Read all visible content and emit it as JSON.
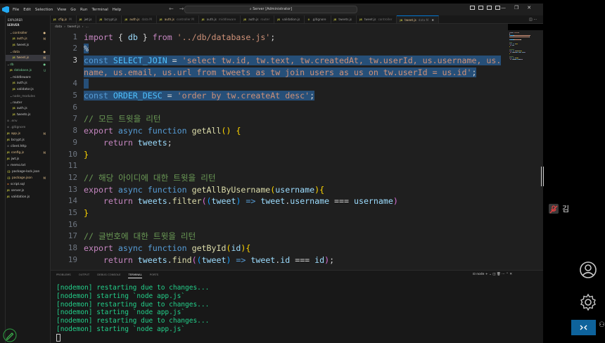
{
  "menu": [
    "File",
    "Edit",
    "Selection",
    "View",
    "Go",
    "Run",
    "Terminal",
    "Help"
  ],
  "command_center": "Server [Administrator]",
  "explorer": {
    "title": "EXPLORER",
    "project": "SERVER",
    "items": [
      {
        "kind": "folder",
        "label": "controller",
        "badge": "●",
        "status": "mod"
      },
      {
        "kind": "js",
        "label": "auth.js",
        "badge": "M",
        "status": "mod"
      },
      {
        "kind": "js",
        "label": "tweet.js",
        "badge": "",
        "status": ""
      },
      {
        "kind": "folder",
        "label": "data",
        "badge": "●",
        "status": "mod"
      },
      {
        "kind": "js",
        "label": "tweet.js",
        "badge": "M",
        "status": "mod",
        "selected": true
      },
      {
        "kind": "folder",
        "label": "db",
        "badge": "●",
        "status": "untr"
      },
      {
        "kind": "js",
        "label": "database.js",
        "badge": "U",
        "status": "untr"
      },
      {
        "kind": "folder",
        "label": "middleware",
        "badge": "",
        "status": ""
      },
      {
        "kind": "js",
        "label": "auth.js",
        "badge": "",
        "status": ""
      },
      {
        "kind": "js",
        "label": "validator.js",
        "badge": "",
        "status": ""
      },
      {
        "kind": "folder",
        "label": "node_modules",
        "badge": "",
        "status": "dim"
      },
      {
        "kind": "folder",
        "label": "router",
        "badge": "",
        "status": ""
      },
      {
        "kind": "js",
        "label": "auth.js",
        "badge": "",
        "status": ""
      },
      {
        "kind": "js",
        "label": "tweets.js",
        "badge": "",
        "status": ""
      },
      {
        "kind": "dot",
        "label": ".env",
        "badge": "",
        "status": "dim"
      },
      {
        "kind": "dot",
        "label": ".gitignore",
        "badge": "",
        "status": "dim"
      },
      {
        "kind": "js",
        "label": "app.js",
        "badge": "M",
        "status": "mod"
      },
      {
        "kind": "js",
        "label": "bcrypt.js",
        "badge": "",
        "status": ""
      },
      {
        "kind": "dot",
        "label": "client.http",
        "badge": "",
        "status": ""
      },
      {
        "kind": "js",
        "label": "config.js",
        "badge": "M",
        "status": "mod"
      },
      {
        "kind": "js",
        "label": "jwt.js",
        "badge": "",
        "status": ""
      },
      {
        "kind": "txt",
        "label": "memo.txt",
        "badge": "",
        "status": ""
      },
      {
        "kind": "json",
        "label": "package-lock.json",
        "badge": "",
        "status": ""
      },
      {
        "kind": "json",
        "label": "package.json",
        "badge": "M",
        "status": "mod"
      },
      {
        "kind": "sql",
        "label": "script.sql",
        "badge": "",
        "status": ""
      },
      {
        "kind": "js",
        "label": "server.js",
        "badge": "",
        "status": ""
      },
      {
        "kind": "js",
        "label": "validation.js",
        "badge": "",
        "status": ""
      }
    ]
  },
  "tabs": [
    {
      "label": "cfig.js",
      "sub": "M",
      "modified": true
    },
    {
      "label": "jwt.js",
      "sub": "",
      "modified": false
    },
    {
      "label": "bcrypt.js",
      "sub": "",
      "modified": false
    },
    {
      "label": "auth.js",
      "sub": "data M",
      "modified": true
    },
    {
      "label": "auth.js",
      "sub": "controller M",
      "modified": true
    },
    {
      "label": "auth.js",
      "sub": "middleware",
      "modified": false
    },
    {
      "label": "auth.js",
      "sub": "router",
      "modified": false
    },
    {
      "label": "validation.js",
      "sub": "",
      "modified": false
    },
    {
      "label": ".gitignore",
      "sub": "",
      "modified": false
    },
    {
      "label": "tweets.js",
      "sub": "",
      "modified": false
    },
    {
      "label": "tweet.js",
      "sub": "controller",
      "modified": false
    },
    {
      "label": "tweet.js",
      "sub": "data M",
      "modified": true,
      "active": true
    }
  ],
  "breadcrumb": [
    "data",
    "tweet.js",
    "..."
  ],
  "line_numbers": [
    "1",
    "2",
    "3",
    "",
    "4",
    "5",
    "6",
    "7",
    "8",
    "9",
    "10",
    "11",
    "12",
    "13",
    "14",
    "15",
    "16",
    "17",
    "18",
    "19"
  ],
  "code_lines": [
    [
      {
        "t": "import ",
        "c": "kwc"
      },
      {
        "t": "{ ",
        "c": "plain"
      },
      {
        "t": "db",
        "c": "var"
      },
      {
        "t": " } ",
        "c": "plain"
      },
      {
        "t": "from ",
        "c": "kwc"
      },
      {
        "t": "'../db/database.js'",
        "c": "str"
      },
      {
        "t": ";",
        "c": "plain"
      }
    ],
    [
      {
        "t": "%",
        "c": "plain",
        "sel": true
      }
    ],
    [
      {
        "t": "const ",
        "c": "kw",
        "sel": true
      },
      {
        "t": "SELECT_JOIN",
        "c": "cst",
        "sel": true
      },
      {
        "t": " = ",
        "c": "plain",
        "sel": true
      },
      {
        "t": "'select tw.id, tw.text, tw.createdAt, tw.userId, us.username, us.",
        "c": "str",
        "sel": true
      }
    ],
    [
      {
        "t": "name, us.email, us.url from tweets as tw join users as us on tw.userId = us.id'",
        "c": "str",
        "sel": true
      },
      {
        "t": ";",
        "c": "plain",
        "sel": true
      }
    ],
    [
      {
        "t": " ",
        "c": "plain",
        "sel": true
      }
    ],
    [
      {
        "t": "const ",
        "c": "kw",
        "sel": true
      },
      {
        "t": "ORDER_DESC",
        "c": "cst",
        "sel": true
      },
      {
        "t": " = ",
        "c": "plain",
        "sel": true
      },
      {
        "t": "'order by tw.createAt desc'",
        "c": "str",
        "sel": true
      },
      {
        "t": ";",
        "c": "plain",
        "sel": true
      }
    ],
    [],
    [
      {
        "t": "// 모든 트윗을 리턴",
        "c": "cmt"
      }
    ],
    [
      {
        "t": "export ",
        "c": "kwc"
      },
      {
        "t": "async ",
        "c": "kw"
      },
      {
        "t": "function ",
        "c": "kw"
      },
      {
        "t": "getAll",
        "c": "fn"
      },
      {
        "t": "() ",
        "c": "brk1"
      },
      {
        "t": "{",
        "c": "brk1"
      }
    ],
    [
      {
        "t": "    ",
        "c": "plain"
      },
      {
        "t": "return ",
        "c": "kwc"
      },
      {
        "t": "tweets",
        "c": "var"
      },
      {
        "t": ";",
        "c": "plain"
      }
    ],
    [
      {
        "t": "}",
        "c": "brk1"
      }
    ],
    [],
    [
      {
        "t": "// 해당 아이디에 대한 트윗을 리턴",
        "c": "cmt"
      }
    ],
    [
      {
        "t": "export ",
        "c": "kwc"
      },
      {
        "t": "async ",
        "c": "kw"
      },
      {
        "t": "function ",
        "c": "kw"
      },
      {
        "t": "getAllByUsername",
        "c": "fn"
      },
      {
        "t": "(",
        "c": "brk1"
      },
      {
        "t": "username",
        "c": "var"
      },
      {
        "t": ")",
        "c": "brk1"
      },
      {
        "t": "{",
        "c": "brk1"
      }
    ],
    [
      {
        "t": "    ",
        "c": "plain"
      },
      {
        "t": "return ",
        "c": "kwc"
      },
      {
        "t": "tweets",
        "c": "var"
      },
      {
        "t": ".",
        "c": "plain"
      },
      {
        "t": "filter",
        "c": "fn"
      },
      {
        "t": "(",
        "c": "brk2"
      },
      {
        "t": "(",
        "c": "brk3"
      },
      {
        "t": "tweet",
        "c": "var"
      },
      {
        "t": ")",
        "c": "brk3"
      },
      {
        "t": " => ",
        "c": "kw"
      },
      {
        "t": "tweet",
        "c": "var"
      },
      {
        "t": ".",
        "c": "plain"
      },
      {
        "t": "username",
        "c": "var"
      },
      {
        "t": " === ",
        "c": "plain"
      },
      {
        "t": "username",
        "c": "var"
      },
      {
        "t": ")",
        "c": "brk2"
      }
    ],
    [
      {
        "t": "}",
        "c": "brk1"
      }
    ],
    [],
    [
      {
        "t": "// 글번호에 대한 트윗을 리턴",
        "c": "cmt"
      }
    ],
    [
      {
        "t": "export ",
        "c": "kwc"
      },
      {
        "t": "async ",
        "c": "kw"
      },
      {
        "t": "function ",
        "c": "kw"
      },
      {
        "t": "getById",
        "c": "fn"
      },
      {
        "t": "(",
        "c": "brk1"
      },
      {
        "t": "id",
        "c": "var"
      },
      {
        "t": ")",
        "c": "brk1"
      },
      {
        "t": "{",
        "c": "brk1"
      }
    ],
    [
      {
        "t": "    ",
        "c": "plain"
      },
      {
        "t": "return ",
        "c": "kwc"
      },
      {
        "t": "tweets",
        "c": "var"
      },
      {
        "t": ".",
        "c": "plain"
      },
      {
        "t": "find",
        "c": "fn"
      },
      {
        "t": "(",
        "c": "brk2"
      },
      {
        "t": "(",
        "c": "brk3"
      },
      {
        "t": "tweet",
        "c": "var"
      },
      {
        "t": ")",
        "c": "brk3"
      },
      {
        "t": " => ",
        "c": "kw"
      },
      {
        "t": "tweet",
        "c": "var"
      },
      {
        "t": ".",
        "c": "plain"
      },
      {
        "t": "id",
        "c": "var"
      },
      {
        "t": " === ",
        "c": "plain"
      },
      {
        "t": "id",
        "c": "var"
      },
      {
        "t": ")",
        "c": "brk2"
      },
      {
        "t": ";",
        "c": "plain"
      }
    ]
  ],
  "panel": {
    "tabs": [
      "PROBLEMS",
      "OUTPUT",
      "DEBUG CONSOLE",
      "TERMINAL",
      "PORTS"
    ],
    "active_tab": "TERMINAL",
    "terminal_name": "node",
    "terminal_lines": [
      "[nodemon] restarting due to changes...",
      "[nodemon] starting `node app.js`",
      "[nodemon] restarting due to changes...",
      "[nodemon] starting `node app.js`",
      "[nodemon] restarting due to changes...",
      "[nodemon] starting `node app.js`"
    ]
  },
  "participant_name": "김",
  "colors": {
    "selection": "#264f78",
    "accent": "#0078d4",
    "terminal_text": "#23d18b",
    "remote_button": "#0e639c"
  }
}
